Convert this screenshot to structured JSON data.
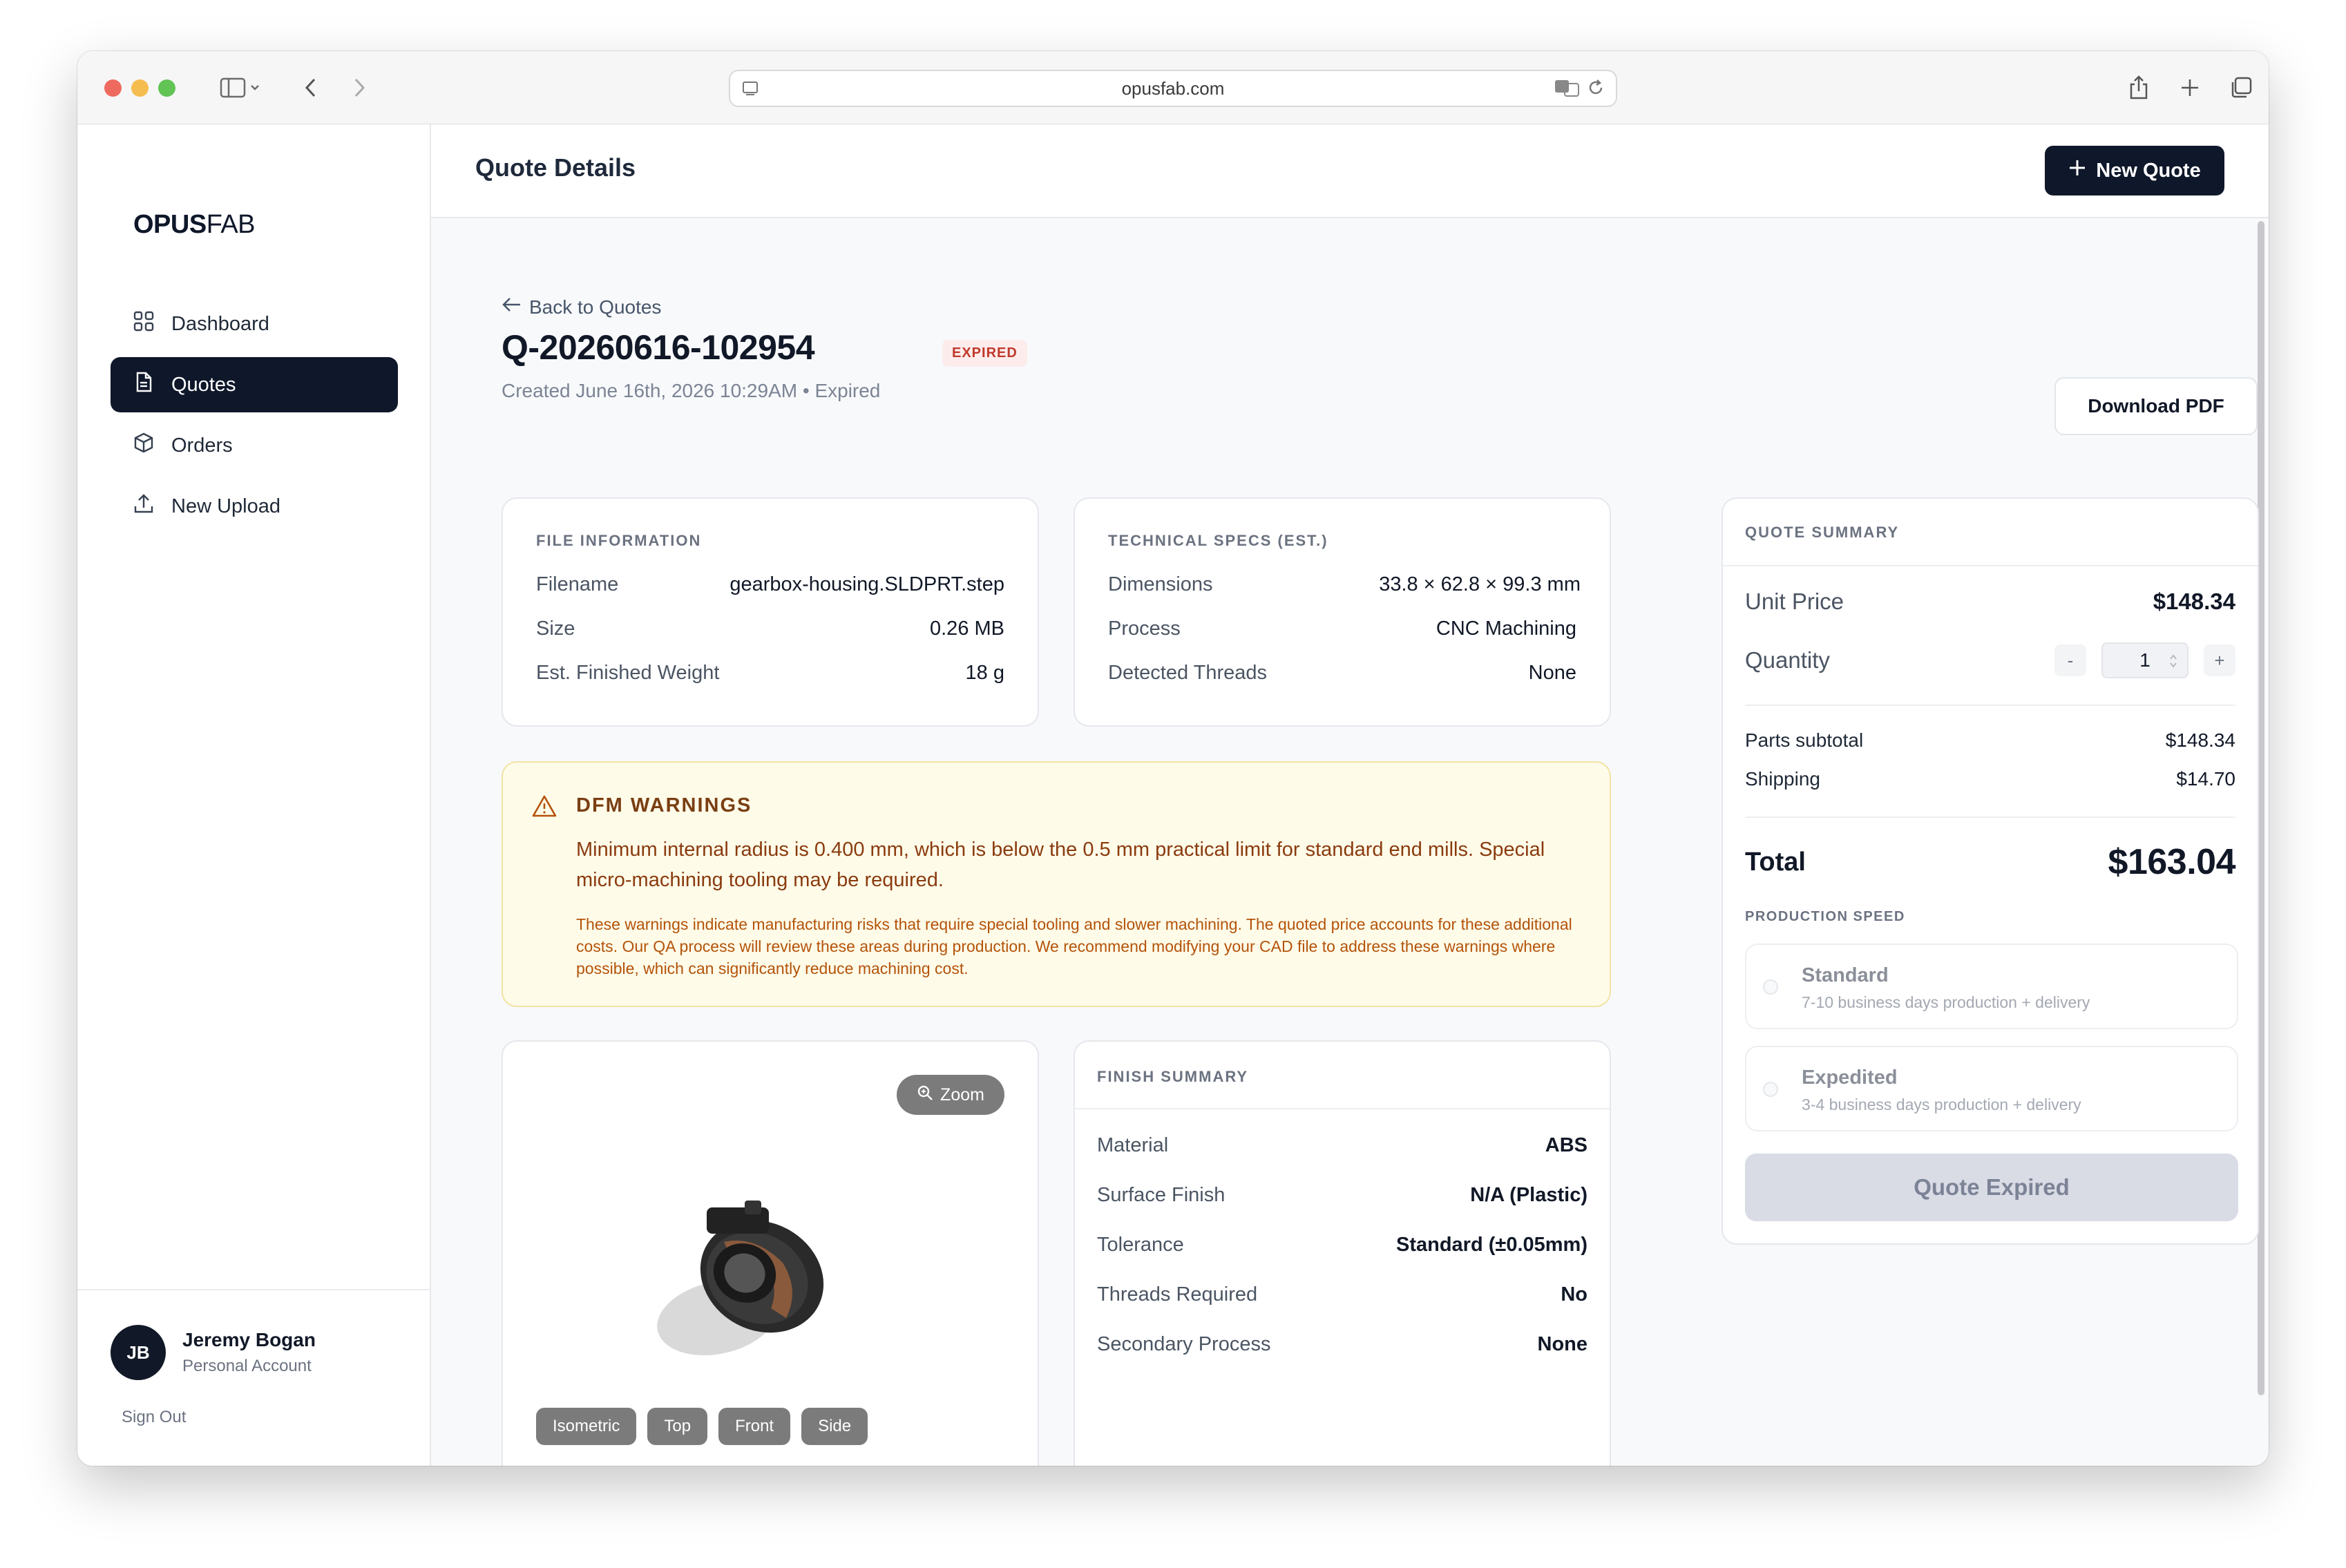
{
  "browser": {
    "url": "opusfab.com"
  },
  "sidebar": {
    "logo_bold": "OPUS",
    "logo_light": "FAB",
    "items": [
      {
        "label": "Dashboard",
        "icon": "grid-icon"
      },
      {
        "label": "Quotes",
        "icon": "document-icon"
      },
      {
        "label": "Orders",
        "icon": "box-icon"
      },
      {
        "label": "New Upload",
        "icon": "upload-icon"
      }
    ],
    "active_item": "Quotes",
    "user": {
      "initials": "JB",
      "name": "Jeremy Bogan",
      "account": "Personal Account",
      "sign_out": "Sign Out"
    }
  },
  "header": {
    "title": "Quote Details",
    "new_quote_label": "New Quote"
  },
  "quote": {
    "back_label": "Back to Quotes",
    "id": "Q-20260616-102954",
    "status": "EXPIRED",
    "created": "Created June 16th, 2026 10:29AM • Expired",
    "download_label": "Download PDF"
  },
  "file_info": {
    "label": "FILE INFORMATION",
    "rows": [
      {
        "k": "Filename",
        "v": "gearbox-housing.SLDPRT.step"
      },
      {
        "k": "Size",
        "v": "0.26 MB"
      },
      {
        "k": "Est. Finished Weight",
        "v": "18 g"
      }
    ]
  },
  "tech_specs": {
    "label": "TECHNICAL SPECS (EST.)",
    "rows": [
      {
        "k": "Dimensions",
        "v": "33.8 × 62.8 × 99.3 mm"
      },
      {
        "k": "Process",
        "v": "CNC Machining"
      },
      {
        "k": "Detected Threads",
        "v": "None"
      }
    ]
  },
  "dfm": {
    "title": "DFM WARNINGS",
    "message": "Minimum internal radius is 0.400 mm, which is below the 0.5 mm practical limit for standard end mills. Special micro-machining tooling may be required.",
    "note": "These warnings indicate manufacturing risks that require special tooling and slower machining. The quoted price accounts for these additional costs. Our QA process will review these areas during production. We recommend modifying your CAD file to address these warnings where possible, which can significantly reduce machining cost."
  },
  "viewer": {
    "zoom_label": "Zoom",
    "views": [
      "Isometric",
      "Top",
      "Front",
      "Side"
    ]
  },
  "finish": {
    "label": "FINISH SUMMARY",
    "rows": [
      {
        "k": "Material",
        "v": "ABS"
      },
      {
        "k": "Surface Finish",
        "v": "N/A (Plastic)"
      },
      {
        "k": "Tolerance",
        "v": "Standard (±0.05mm)"
      },
      {
        "k": "Threads Required",
        "v": "No"
      },
      {
        "k": "Secondary Process",
        "v": "None"
      }
    ]
  },
  "summary": {
    "label": "QUOTE SUMMARY",
    "unit_price_label": "Unit Price",
    "unit_price": "$148.34",
    "quantity_label": "Quantity",
    "quantity": "1",
    "minus": "-",
    "plus": "+",
    "subtotal_label": "Parts subtotal",
    "subtotal": "$148.34",
    "shipping_label": "Shipping",
    "shipping": "$14.70",
    "total_label": "Total",
    "total": "$163.04",
    "speed_label": "PRODUCTION SPEED",
    "speeds": [
      {
        "title": "Standard",
        "sub": "7-10 business days production + delivery"
      },
      {
        "title": "Expedited",
        "sub": "3-4 business days production + delivery"
      }
    ],
    "cta_label": "Quote Expired"
  },
  "colors": {
    "primary": "#0f172a",
    "expired_badge": "#c0392b",
    "warning_bg": "#fefbe9",
    "warning_text": "#8a3b0e"
  }
}
